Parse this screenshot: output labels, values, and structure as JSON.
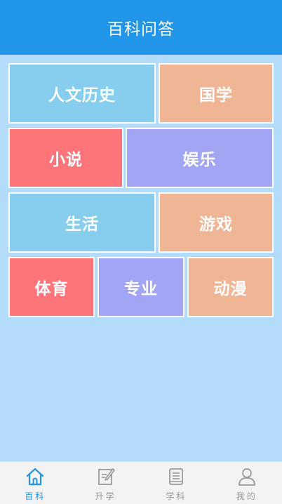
{
  "header": {
    "title": "百科问答"
  },
  "tiles": [
    {
      "label": "人文历史",
      "color": "#87ceee"
    },
    {
      "label": "国学",
      "color": "#efb595"
    },
    {
      "label": "小说",
      "color": "#fd7479"
    },
    {
      "label": "娱乐",
      "color": "#a2a5f3"
    },
    {
      "label": "生活",
      "color": "#87ceee"
    },
    {
      "label": "游戏",
      "color": "#efb595"
    },
    {
      "label": "体育",
      "color": "#fd7479"
    },
    {
      "label": "专业",
      "color": "#a2a5f3"
    },
    {
      "label": "动漫",
      "color": "#efb595"
    }
  ],
  "tabbar": {
    "items": [
      {
        "label": "百科",
        "icon": "home-icon",
        "active": true
      },
      {
        "label": "升学",
        "icon": "edit-icon",
        "active": false
      },
      {
        "label": "学科",
        "icon": "book-icon",
        "active": false
      },
      {
        "label": "我的",
        "icon": "user-icon",
        "active": false
      }
    ],
    "active_color": "#2196e8",
    "inactive_color": "#999999"
  }
}
